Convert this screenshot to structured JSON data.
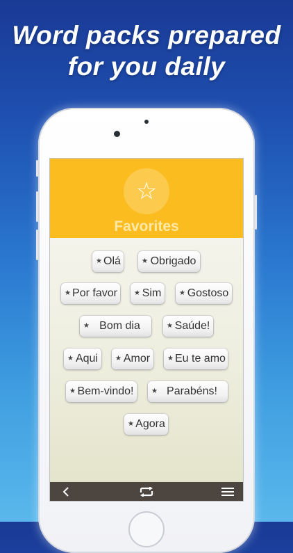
{
  "headline": {
    "line1": "Word packs prepared",
    "line2": "for you daily"
  },
  "screen": {
    "title": "Favorites",
    "chips": [
      {
        "label": "Olá"
      },
      {
        "label": "Obrigado"
      },
      {
        "label": "Por favor"
      },
      {
        "label": "Sim"
      },
      {
        "label": "Gostoso"
      },
      {
        "label": "Bom dia"
      },
      {
        "label": "Saúde!"
      },
      {
        "label": "Aqui"
      },
      {
        "label": "Amor"
      },
      {
        "label": "Eu te amo"
      },
      {
        "label": "Bem-vindo!"
      },
      {
        "label": "Parabéns!"
      },
      {
        "label": "Agora"
      }
    ],
    "toolbar": {
      "back_icon": "chevron-left-icon",
      "sync_icon": "sync-arrows-icon",
      "menu_icon": "hamburger-menu-icon"
    }
  },
  "colors": {
    "header": "#fbbc20",
    "toolbar": "#4c4540"
  }
}
